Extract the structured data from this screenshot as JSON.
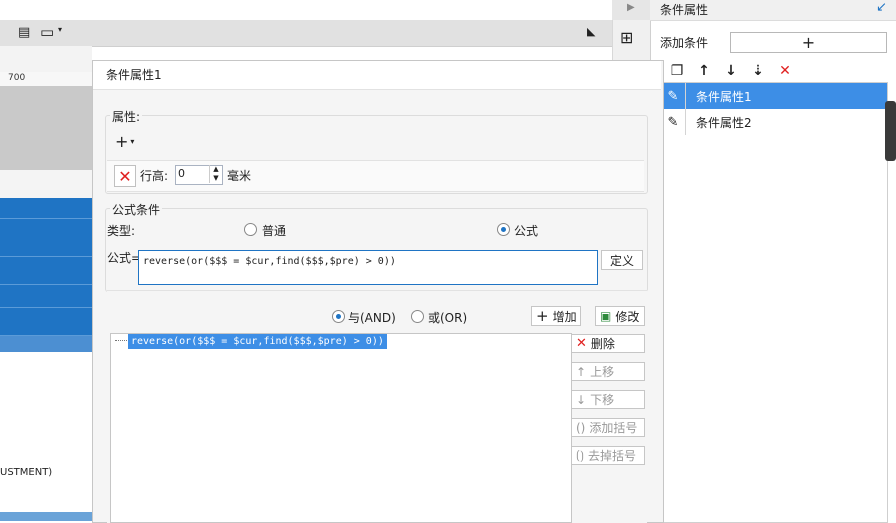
{
  "panel": {
    "title": "条件属性",
    "add_condition_label": "添加条件",
    "add_button_glyph": "+",
    "toolbar_icons": [
      "copy-icon",
      "arrow-up-icon",
      "arrow-down-icon",
      "sort-bottom-icon",
      "delete-icon"
    ],
    "conditions": [
      {
        "label": "条件属性1",
        "selected": true,
        "icon": "edit-icon"
      },
      {
        "label": "条件属性2",
        "selected": false,
        "icon": "edit-icon"
      }
    ]
  },
  "background": {
    "ruler_label": "700",
    "report_text": "USTMENT)"
  },
  "dialog": {
    "title": "条件属性1",
    "attributes": {
      "group_label": "属性:",
      "row_height_label": "行高:",
      "row_height_value": "0",
      "unit": "毫米"
    },
    "formula_condition": {
      "group_label": "公式条件",
      "type_label": "类型:",
      "type_options": [
        {
          "label": "普通",
          "selected": false
        },
        {
          "label": "公式",
          "selected": true
        }
      ],
      "formula_label": "公式=",
      "formula_value": "reverse(or($$$ = $cur,find($$$,$pre) > 0))",
      "define_button": "定义"
    },
    "logic": {
      "and_label": "与(AND)",
      "or_label": "或(OR)",
      "and_selected": true,
      "add_button": "增加",
      "modify_button": "修改"
    },
    "expression_list": [
      "reverse(or($$$ = $cur,find($$$,$pre) > 0))"
    ],
    "side_buttons": [
      {
        "label": "删除",
        "enabled": true,
        "icon": "close-icon"
      },
      {
        "label": "上移",
        "enabled": false,
        "icon": "arrow-up-icon"
      },
      {
        "label": "下移",
        "enabled": false,
        "icon": "arrow-down-icon"
      },
      {
        "label": "添加括号",
        "enabled": false,
        "icon": "parentheses-icon"
      },
      {
        "label": "去掉括号",
        "enabled": false,
        "icon": "remove-parentheses-icon"
      }
    ]
  },
  "colors": {
    "accent": "#1f74c4",
    "selection": "#3d8ee6",
    "delete_red": "#e02020"
  }
}
